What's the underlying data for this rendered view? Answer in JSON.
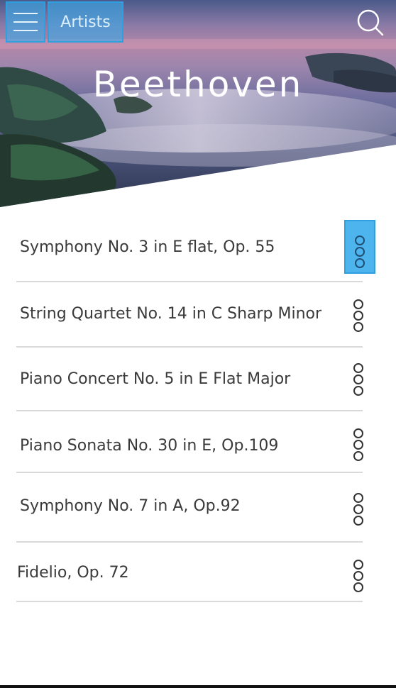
{
  "header": {
    "back_label": "Artists",
    "title": "Beethoven",
    "menu_icon": "hamburger-icon",
    "search_icon": "search-icon"
  },
  "colors": {
    "accent": "#3aaae8",
    "accent_border": "#2f9fe0",
    "text": "#3a3a3a",
    "divider": "#d9d9d9"
  },
  "tracks": [
    {
      "title": "Symphony No. 3 in E flat, Op. 55",
      "more_icon": "more-options-icon",
      "selected": true
    },
    {
      "title": "String Quartet No. 14 in C Sharp Minor",
      "more_icon": "more-options-icon",
      "selected": false
    },
    {
      "title": "Piano Concert No. 5 in E Flat Major",
      "more_icon": "more-options-icon",
      "selected": false
    },
    {
      "title": "Piano Sonata No. 30 in E, Op.109",
      "more_icon": "more-options-icon",
      "selected": false
    },
    {
      "title": "Symphony No. 7 in A, Op.92",
      "more_icon": "more-options-icon",
      "selected": false
    },
    {
      "title": "Fidelio, Op. 72",
      "more_icon": "more-options-icon",
      "selected": false
    }
  ]
}
